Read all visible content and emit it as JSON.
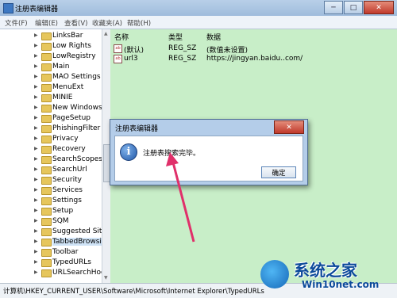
{
  "window": {
    "title": "注册表编辑器",
    "controls": {
      "minimize": "─",
      "maximize": "□",
      "close": "✕"
    }
  },
  "menubar": [
    "文件(F)",
    "编辑(E)",
    "查看(V)",
    "收藏夹(A)",
    "帮助(H)"
  ],
  "tree": {
    "selected_index": 20,
    "items": [
      "LinksBar",
      "Low Rights",
      "LowRegistry",
      "Main",
      "MAO Settings",
      "MenuExt",
      "MINIE",
      "New Windows",
      "PageSetup",
      "PhishingFilter",
      "Privacy",
      "Recovery",
      "SearchScopes",
      "SearchUrl",
      "Security",
      "Services",
      "Settings",
      "Setup",
      "SQM",
      "Suggested Site",
      "TabbedBrowsi",
      "Toolbar",
      "TypedURLs",
      "URLSearchHoo"
    ]
  },
  "list": {
    "columns": {
      "name": "名称",
      "type": "类型",
      "data": "数据"
    },
    "rows": [
      {
        "name": "(默认)",
        "type": "REG_SZ",
        "data": "(数值未设置)"
      },
      {
        "name": "url3",
        "type": "REG_SZ",
        "data": "https://jingyan.baidu..com/"
      }
    ]
  },
  "statusbar": {
    "path": "计算机\\HKEY_CURRENT_USER\\Software\\Microsoft\\Internet Explorer\\TypedURLs"
  },
  "dialog": {
    "title": "注册表编辑器",
    "message": "注册表搜索完毕。",
    "ok_label": "确定",
    "close_label": "✕",
    "icon": "info-icon"
  },
  "watermark": {
    "title": "系统之家",
    "subtitle": "Win10net.com"
  },
  "colors": {
    "list_bg": "#c8eec8",
    "arrow": "#e0306a",
    "accent": "#3d78c2"
  }
}
